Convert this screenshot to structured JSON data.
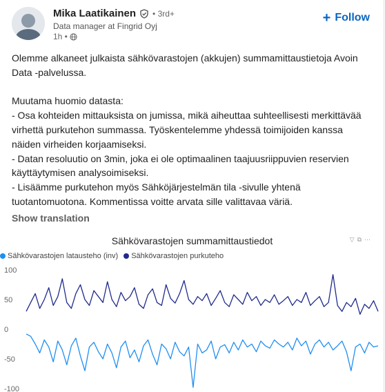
{
  "author": {
    "name": "Mika Laatikainen",
    "degree": "• 3rd+",
    "headline": "Data manager at Fingrid Oyj",
    "time": "1h •"
  },
  "follow_label": "Follow",
  "post": {
    "paragraphs": [
      "Olemme alkaneet julkaista sähkövarastojen (akkujen) summamittaustietoja Avoin Data -palvelussa.",
      "",
      "Muutama huomio datasta:",
      "- Osa kohteiden mittauksista on jumissa, mikä aiheuttaa suhteellisesti merkittävää virhettä purkutehon summassa. Työskentelemme yhdessä toimijoiden kanssa näiden virheiden korjaamiseksi.",
      "- Datan resoluutio on 3min, joka ei ole optimaalinen taajuusriippuvien reservien käyttäytymisen analysoimiseksi.",
      "- Lisäämme purkutehon myös Sähköjärjestelmän tila -sivulle yhtenä tuotantomuotona. Kommentissa voitte arvata sille valittavaa väriä."
    ]
  },
  "show_translation": "Show translation",
  "chart_data": {
    "type": "line",
    "title": "Sähkövarastojen summamittaustiedot",
    "ylim": [
      -100,
      100
    ],
    "yticks": [
      "100",
      "50",
      "0",
      "-50",
      "-100"
    ],
    "grid": false,
    "legend_position": "top-left",
    "series": [
      {
        "name": "Sähkövarastojen latausteho (inv)",
        "color": "#1f8ef1",
        "values": [
          -8,
          -12,
          -25,
          -40,
          -18,
          -30,
          -55,
          -20,
          -35,
          -60,
          -28,
          -15,
          -45,
          -70,
          -30,
          -22,
          -38,
          -50,
          -25,
          -40,
          -65,
          -30,
          -20,
          -48,
          -35,
          -55,
          -28,
          -18,
          -42,
          -60,
          -25,
          -33,
          -50,
          -22,
          -38,
          -45,
          -30,
          -98,
          -25,
          -40,
          -35,
          -20,
          -50,
          -30,
          -26,
          -40,
          -22,
          -35,
          -18,
          -30,
          -25,
          -38,
          -20,
          -28,
          -32,
          -18,
          -25,
          -30,
          -22,
          -35,
          -15,
          -28,
          -20,
          -42,
          -25,
          -18,
          -30,
          -22,
          -35,
          -28,
          -20,
          -38,
          -70,
          -30,
          -25,
          -40,
          -22,
          -30,
          -28
        ]
      },
      {
        "name": "Sähkövarastojen purkuteho",
        "color": "#1e2a8c",
        "values": [
          30,
          45,
          60,
          35,
          50,
          70,
          40,
          55,
          85,
          45,
          35,
          60,
          75,
          50,
          40,
          65,
          55,
          45,
          80,
          50,
          38,
          62,
          48,
          55,
          70,
          42,
          35,
          58,
          68,
          45,
          40,
          75,
          52,
          44,
          60,
          82,
          50,
          42,
          55,
          48,
          60,
          40,
          52,
          65,
          45,
          38,
          58,
          50,
          42,
          62,
          48,
          55,
          40,
          50,
          45,
          58,
          42,
          48,
          55,
          40,
          50,
          45,
          62,
          40,
          48,
          55,
          38,
          45,
          92,
          40,
          30,
          45,
          38,
          52,
          25,
          42,
          35,
          48,
          30
        ]
      }
    ]
  }
}
